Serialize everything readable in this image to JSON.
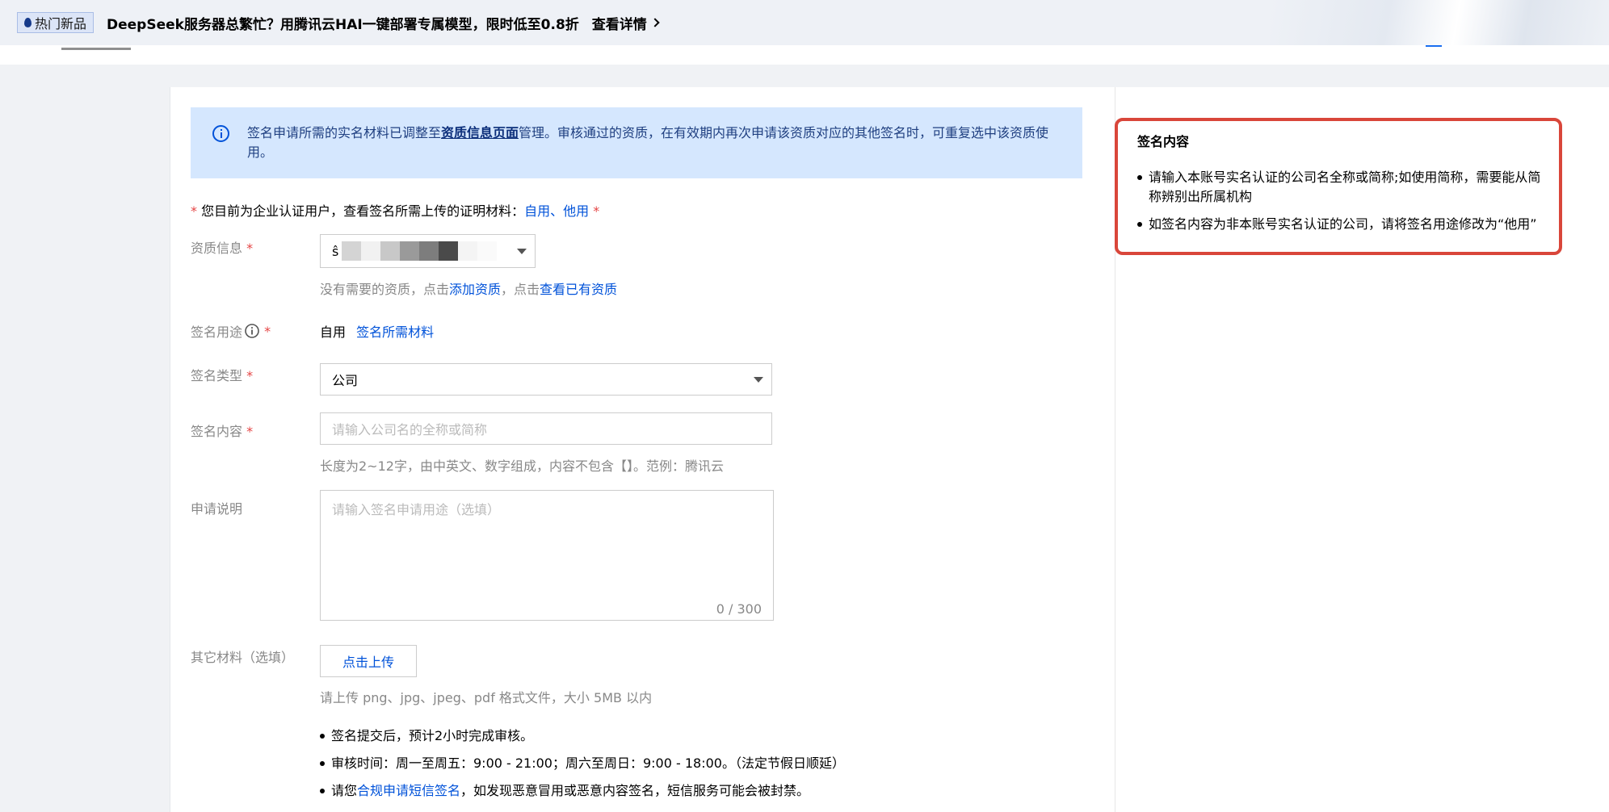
{
  "banner": {
    "badge": "热门新品",
    "text": "DeepSeek服务器总繁忙？用腾讯云HAI一键部署专属模型，限时低至0.8折",
    "link": "查看详情"
  },
  "notice": {
    "pre": "签名申请所需的实名材料已调整至",
    "strong": "资质信息页面",
    "post": "管理。审核通过的资质，在有效期内再次申请该资质对应的其他签名时，可重复选中该资质使用。"
  },
  "tip": {
    "pre": "您目前为企业认证用户，查看签名所需上传的证明材料：",
    "link_self": "自用",
    "sep": "、",
    "link_other": "他用"
  },
  "form": {
    "qualification": {
      "label": "资质信息",
      "value": "ŝ",
      "help_pre": "没有需要的资质，点击",
      "help_link1": "添加资质",
      "help_mid": "，点击",
      "help_link2": "查看已有资质"
    },
    "purpose": {
      "label": "签名用途",
      "value": "自用",
      "link": "签名所需材料"
    },
    "type": {
      "label": "签名类型",
      "value": "公司"
    },
    "content": {
      "label": "签名内容",
      "placeholder": "请输入公司名的全称或简称",
      "help": "长度为2~12字，由中英文、数字组成，内容不包含【】。范例：腾讯云"
    },
    "description": {
      "label": "申请说明",
      "placeholder": "请输入签名申请用途（选填）",
      "count": "0 / 300"
    },
    "other": {
      "label": "其它材料（选填）",
      "button": "点击上传",
      "help": "请上传 png、jpg、jpeg、pdf 格式文件，大小 5MB 以内"
    }
  },
  "notes": {
    "n1": "签名提交后，预计2小时完成审核。",
    "n2": "审核时间：周一至周五：9:00 - 21:00；周六至周日：9:00 - 18:00。（法定节假日顺延）",
    "n3_pre": "请您",
    "n3_link": "合规申请短信签名",
    "n3_post": "，如发现恶意冒用或恶意内容签名，短信服务可能会被封禁。"
  },
  "side": {
    "title": "签名内容",
    "item1": "请输入本账号实名认证的公司名全称或简称;如使用简称，需要能从简称辨别出所属机构",
    "item2": "如签名内容为非本账号实名认证的公司，请将签名用途修改为“他用”"
  },
  "icons": {
    "info": "info-circle-icon",
    "help": "help-circle-icon",
    "chevron": "chevron-right-icon",
    "caret": "caret-down-icon",
    "flame": "flame-icon"
  },
  "colors": {
    "link": "#0052d9",
    "required": "#e54545",
    "notice_bg": "#d5e7fe",
    "highlight_border": "#d9463a"
  }
}
